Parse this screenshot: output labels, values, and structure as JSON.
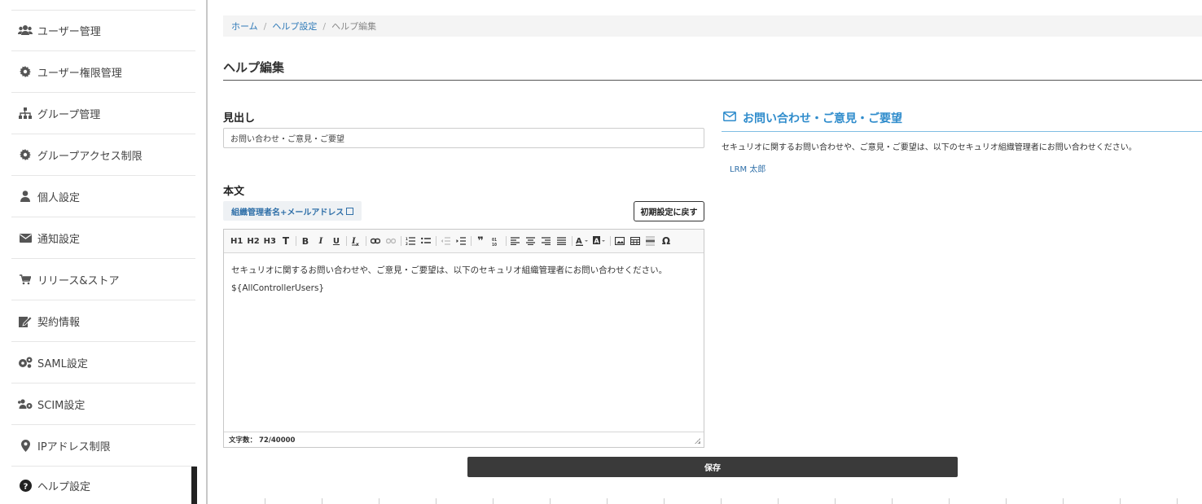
{
  "sidebar": {
    "items": [
      {
        "label": "ユーザー管理",
        "icon": "users-icon"
      },
      {
        "label": "ユーザー権限管理",
        "icon": "gear-icon"
      },
      {
        "label": "グループ管理",
        "icon": "sitemap-icon"
      },
      {
        "label": "グループアクセス制限",
        "icon": "gear-icon"
      },
      {
        "label": "個人設定",
        "icon": "user-icon"
      },
      {
        "label": "通知設定",
        "icon": "envelope-icon"
      },
      {
        "label": "リリース&ストア",
        "icon": "cart-icon"
      },
      {
        "label": "契約情報",
        "icon": "contract-edit-icon"
      },
      {
        "label": "SAML設定",
        "icon": "gears-icon"
      },
      {
        "label": "SCIM設定",
        "icon": "users-gear-icon"
      },
      {
        "label": "IPアドレス制限",
        "icon": "map-marker-icon"
      },
      {
        "label": "ヘルプ設定",
        "icon": "question-circle-icon",
        "active": true
      }
    ]
  },
  "breadcrumb": {
    "home": "ホーム",
    "help_settings": "ヘルプ設定",
    "current": "ヘルプ編集",
    "separator": "/"
  },
  "page": {
    "title": "ヘルプ編集"
  },
  "form": {
    "heading_label": "見出し",
    "heading_value": "お問い合わせ・ご意見・ご要望",
    "body_label": "本文",
    "insert_button": "組織管理者名+メールアドレス",
    "reset_button": "初期設定に戻す",
    "toolbar": [
      "H1",
      "H2",
      "H3",
      "T",
      "B",
      "I",
      "U",
      "Ix",
      "link",
      "unlink",
      "ol",
      "ul",
      "outdent",
      "indent",
      "quote",
      "code",
      "align-left",
      "align-center",
      "align-right",
      "justify",
      "A",
      "bg",
      "image",
      "table",
      "hr",
      "Ω"
    ],
    "toolbar_text": {
      "h1": "H1",
      "h2": "H2",
      "h3": "H3",
      "t": "T",
      "b": "B",
      "i": "I",
      "u": "U",
      "omega": "Ω"
    },
    "body_line1": "セキュリオに関するお問い合わせや、ご意見・ご要望は、以下のセキュリオ組織管理者にお問い合わせください。",
    "body_line2": "${AllControllerUsers}",
    "char_count": "文字数： 72/40000",
    "save_button": "保存"
  },
  "preview": {
    "title": "お問い合わせ・ご意見・ご要望",
    "text": "セキュリオに関するお問い合わせや、ご意見・ご要望は、以下のセキュリオ組織管理者にお問い合わせください。",
    "user": "LRM 太郎"
  },
  "colors": {
    "link": "#2f7ab8",
    "preview_title": "#2f8ccc",
    "save_button_bg": "#3a3a3a"
  }
}
